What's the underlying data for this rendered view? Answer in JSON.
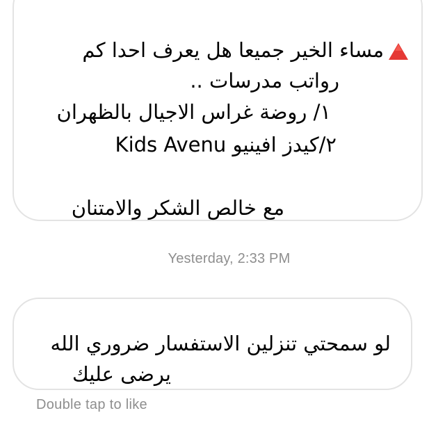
{
  "thread": {
    "received_message": {
      "icon": "red-triangle-icon",
      "icon_color": "#e53935",
      "lines": [
        "مساء الخير جميعا هل يعرف احدا كم",
        "رواتب مدرسات ..",
        "١/ روضة غراس الاجيال بالظهران",
        "٢/كيدز افينيو Kids Avenu",
        "مع خالص الشكر والامتنان"
      ]
    },
    "timestamp": "Yesterday, 2:33 PM",
    "reply_message": {
      "lines": [
        "لو سمحتي تنزلين الاستفسار ضروري الله",
        "يرضى عليك"
      ]
    },
    "like_hint": "Double tap to like"
  },
  "colors": {
    "bubble_border": "#e3e3e3",
    "text": "#111111",
    "meta_text": "#8e8e8e",
    "background": "#ffffff"
  }
}
